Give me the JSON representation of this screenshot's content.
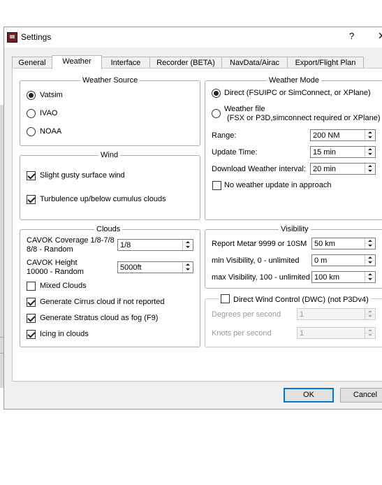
{
  "window": {
    "title": "Settings",
    "help": "?",
    "close": "✕"
  },
  "tabs": [
    {
      "label": "General"
    },
    {
      "label": "Weather"
    },
    {
      "label": "Interface"
    },
    {
      "label": "Recorder (BETA)"
    },
    {
      "label": "NavData/Airac"
    },
    {
      "label": "Export/Flight Plan"
    }
  ],
  "active_tab": "Weather",
  "weather_source": {
    "title": "Weather Source",
    "options": [
      {
        "label": "Vatsim"
      },
      {
        "label": "IVAO"
      },
      {
        "label": "NOAA"
      }
    ],
    "selected": "Vatsim"
  },
  "wind": {
    "title": "Wind",
    "slight_gusty": {
      "label": "Slight gusty surface wind",
      "checked": true
    },
    "turbulence": {
      "label": "Turbulence up/below cumulus clouds",
      "checked": true
    }
  },
  "clouds": {
    "title": "Clouds",
    "cavok_coverage": {
      "label_line1": "CAVOK Coverage 1/8-7/8",
      "label_line2": "8/8 - Random",
      "value": "1/8"
    },
    "cavok_height": {
      "label_line1": "CAVOK Height",
      "label_line2": "10000 - Random",
      "value": "5000ft"
    },
    "mixed": {
      "label": "Mixed Clouds",
      "checked": false
    },
    "cirrus": {
      "label": "Generate Cirrus cloud if not reported",
      "checked": true
    },
    "stratus": {
      "label": "Generate Stratus cloud as fog (F9)",
      "checked": true
    },
    "icing": {
      "label": "Icing in clouds",
      "checked": true
    }
  },
  "weather_mode": {
    "title": "Weather Mode",
    "direct": {
      "label": "Direct (FSUIPC or SimConnect, or XPlane)"
    },
    "file": {
      "label_line1": "Weather file",
      "label_line2": "(FSX or P3D,simconnect required or XPlane)"
    },
    "selected": "Direct",
    "range": {
      "label": "Range:",
      "value": "200 NM"
    },
    "update_time": {
      "label": "Update Time:",
      "value": "15 min"
    },
    "download_interval": {
      "label": "Download Weather interval:",
      "value": "20 min"
    },
    "no_update_approach": {
      "label": "No weather update in approach",
      "checked": false
    }
  },
  "visibility": {
    "title": "Visibility",
    "report_metar": {
      "label": "Report Metar 9999 or 10SM",
      "value": "50 km"
    },
    "min_visibility": {
      "label": "min Visibility, 0 - unlimited",
      "value": "0 m"
    },
    "max_visibility": {
      "label": "max Visibility, 100 - unlimited",
      "value": "100 km"
    }
  },
  "dwc": {
    "title": "Direct Wind Control (DWC) (not P3Dv4)",
    "checked": false,
    "degrees": {
      "label": "Degrees per second",
      "value": "1"
    },
    "knots": {
      "label": "Knots per second",
      "value": "1"
    }
  },
  "buttons": {
    "ok": "OK",
    "cancel": "Cancel"
  },
  "colors": {
    "accent": "#0078d7",
    "disabled_text": "#9a9a9a",
    "window_bg": "#f0f0f0"
  }
}
